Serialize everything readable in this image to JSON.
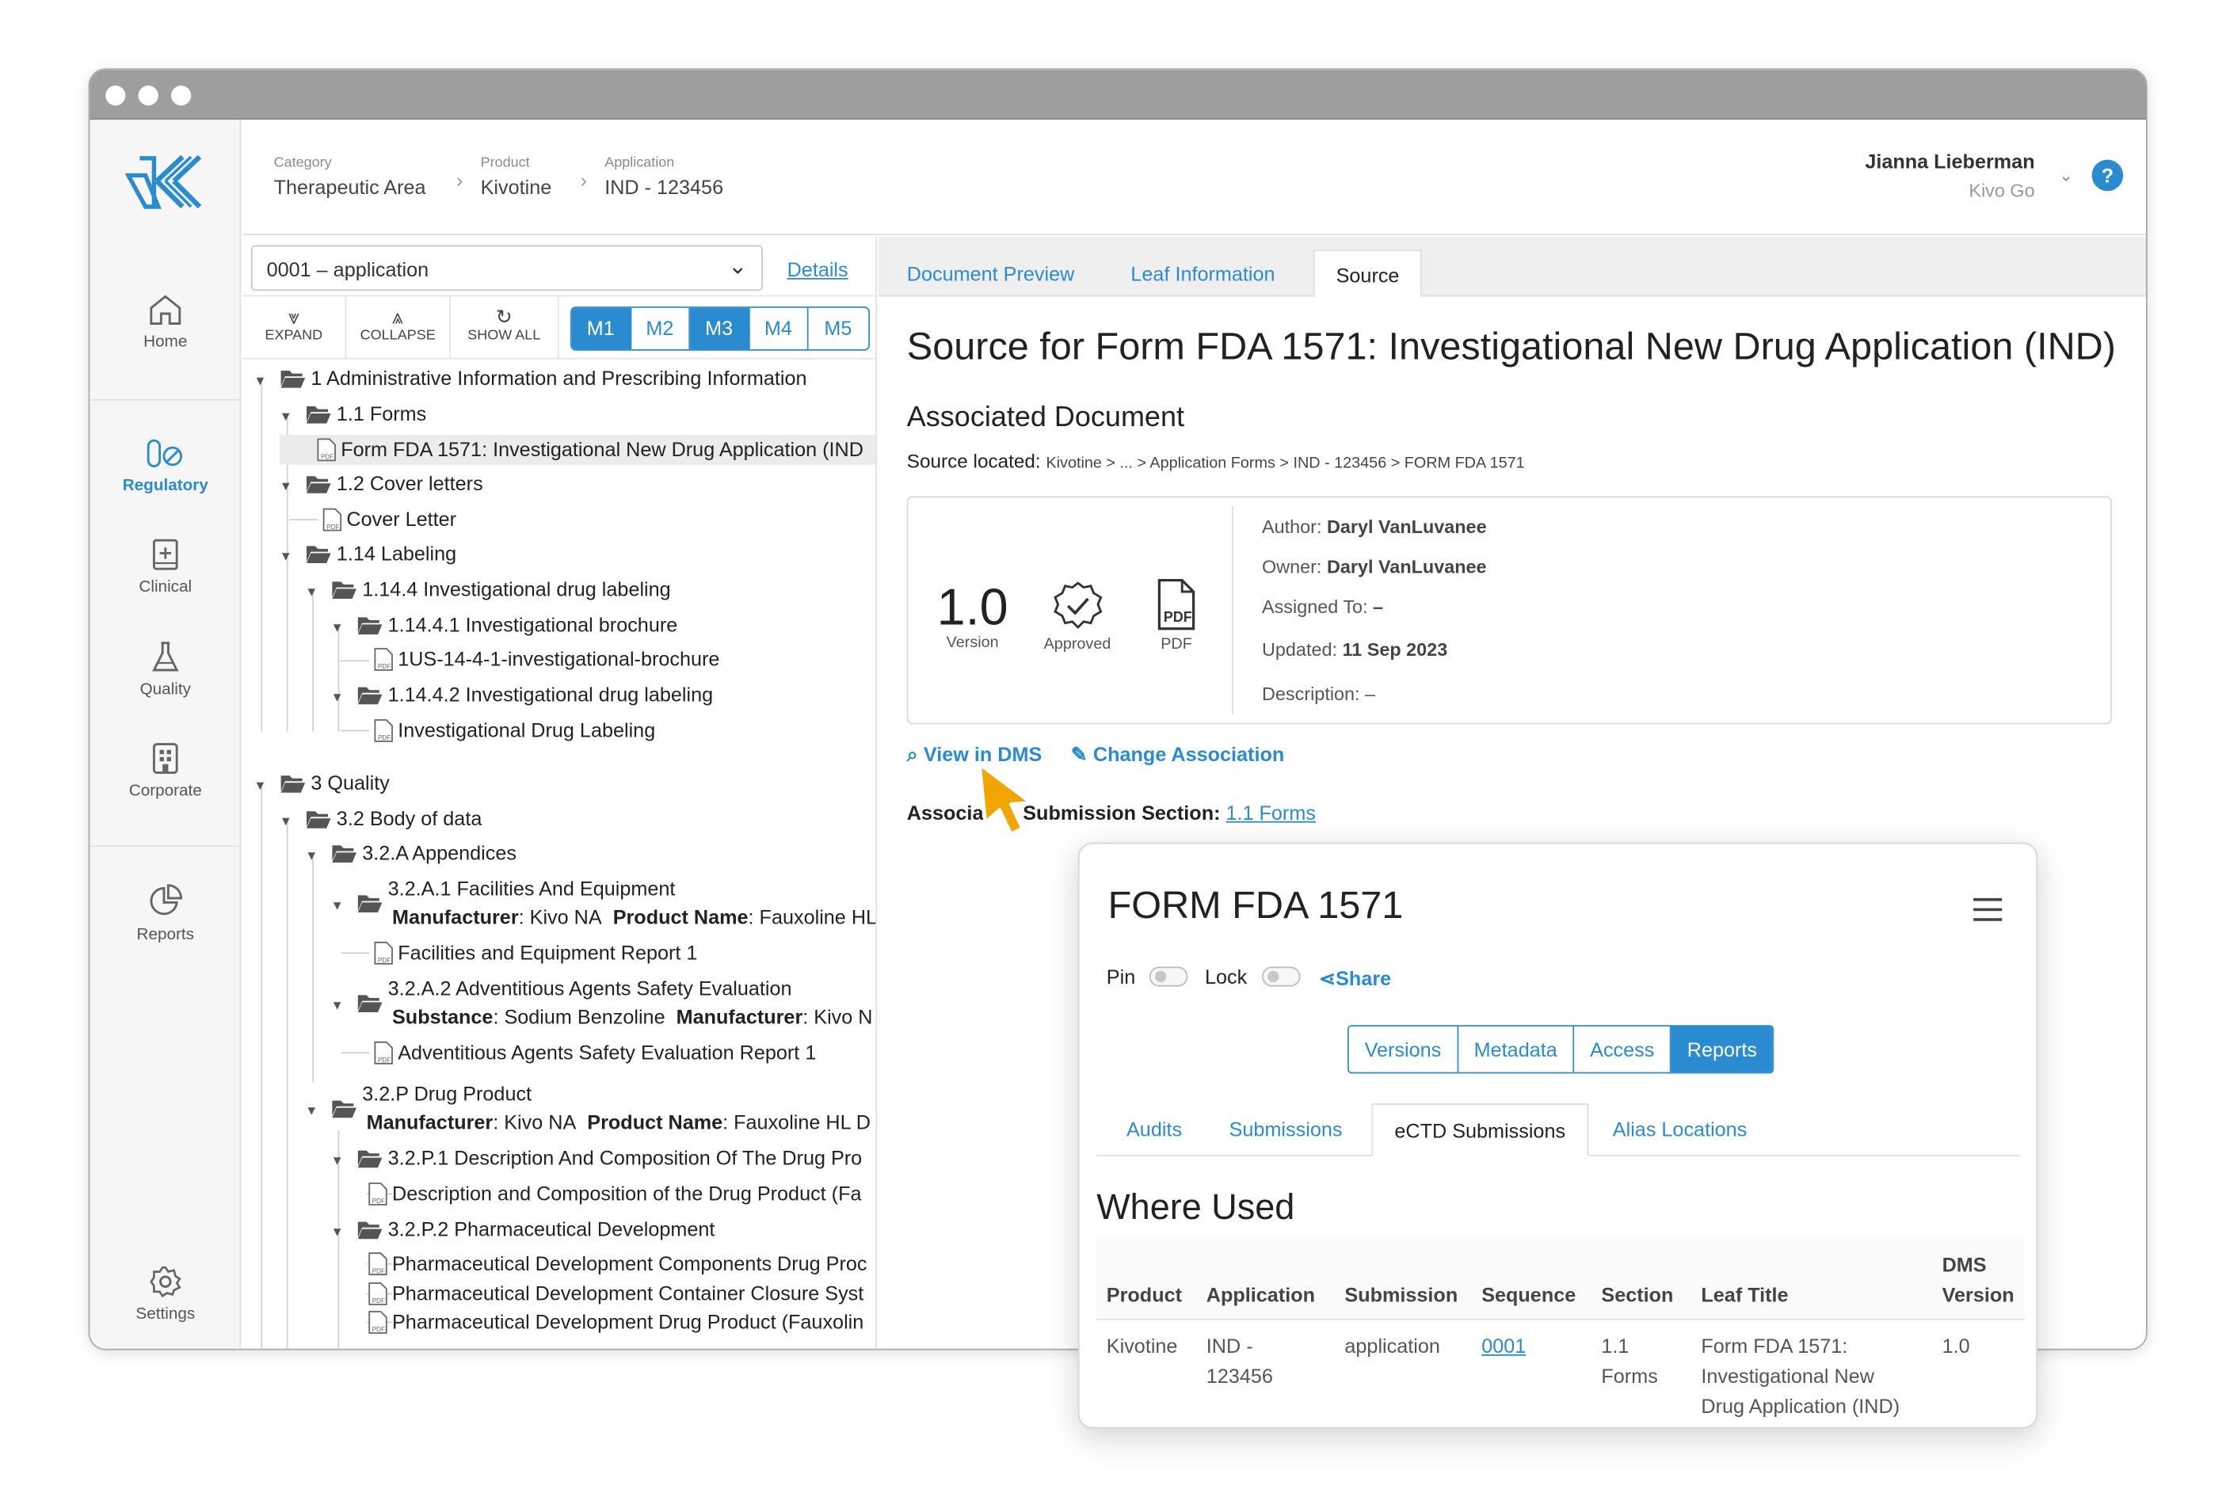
{
  "header": {
    "breadcrumbs": [
      {
        "label": "Category",
        "value": "Therapeutic Area"
      },
      {
        "label": "Product",
        "value": "Kivotine"
      },
      {
        "label": "Application",
        "value": "IND - 123456"
      }
    ],
    "user_name": "Jianna Lieberman",
    "user_org": "Kivo Go",
    "help_label": "?"
  },
  "sidebar": {
    "items": [
      {
        "label": "Home",
        "icon": "home-icon"
      },
      {
        "label": "Regulatory",
        "icon": "pill-icon",
        "active": true
      },
      {
        "label": "Clinical",
        "icon": "medical-book-icon"
      },
      {
        "label": "Quality",
        "icon": "flask-icon"
      },
      {
        "label": "Corporate",
        "icon": "building-icon"
      },
      {
        "label": "Reports",
        "icon": "pie-chart-icon"
      },
      {
        "label": "Settings",
        "icon": "gear-icon"
      }
    ]
  },
  "tree_pane": {
    "application_select": "0001 – application",
    "details_link": "Details",
    "toolbar": {
      "expand": "EXPAND",
      "collapse": "COLLAPSE",
      "show_all": "SHOW ALL"
    },
    "modules": [
      "M1",
      "M2",
      "M3",
      "M4",
      "M5"
    ],
    "active_modules": [
      "M1",
      "M3"
    ],
    "nodes": [
      {
        "label": "1 Administrative Information and Prescribing Information",
        "type": "folder"
      },
      {
        "label": "1.1 Forms",
        "type": "folder"
      },
      {
        "label": "Form FDA 1571: Investigational New Drug Application (IND",
        "type": "document",
        "selected": true
      },
      {
        "label": "1.2 Cover letters",
        "type": "folder"
      },
      {
        "label": "Cover Letter",
        "type": "document"
      },
      {
        "label": "1.14 Labeling",
        "type": "folder"
      },
      {
        "label": "1.14.4 Investigational drug labeling",
        "type": "folder"
      },
      {
        "label": "1.14.4.1 Investigational brochure",
        "type": "folder"
      },
      {
        "label": "1US-14-4-1-investigational-brochure",
        "type": "document"
      },
      {
        "label": "1.14.4.2 Investigational drug labeling",
        "type": "folder"
      },
      {
        "label": "Investigational Drug Labeling",
        "type": "document"
      },
      {
        "label": "3 Quality",
        "type": "folder"
      },
      {
        "label": "3.2 Body of data",
        "type": "folder"
      },
      {
        "label": "3.2.A Appendices",
        "type": "folder"
      },
      {
        "label": "3.2.A.1 Facilities And Equipment",
        "type": "folder"
      },
      {
        "label": "Facilities and Equipment Report 1",
        "type": "document"
      },
      {
        "label": "3.2.A.2 Adventitious Agents Safety Evaluation",
        "type": "folder"
      },
      {
        "label": "Adventitious Agents Safety Evaluation Report 1",
        "type": "document"
      },
      {
        "label": "3.2.P Drug Product",
        "type": "folder"
      },
      {
        "label": "3.2.P.1 Description And Composition Of The Drug Pro",
        "type": "folder"
      },
      {
        "label": "Description and Composition of the Drug Product (Fa",
        "type": "document"
      },
      {
        "label": "3.2.P.2 Pharmaceutical Development",
        "type": "folder"
      },
      {
        "label": "Pharmaceutical Development Components Drug Proc",
        "type": "document"
      },
      {
        "label": "Pharmaceutical Development Container Closure Syst",
        "type": "document"
      },
      {
        "label": "Pharmaceutical Development Drug Product (Fauxolin",
        "type": "document"
      }
    ],
    "attributes": {
      "a1_k1": "Manufacturer",
      "a1_v1": ": Kivo NA",
      "a1_k2": "Product Name",
      "a1_v2": ": Fauxoline HL",
      "a2_k1": "Substance",
      "a2_v1": ": Sodium Benzoline",
      "a2_k2": "Manufacturer",
      "a2_v2": ": Kivo N",
      "p_k1": "Manufacturer",
      "p_v1": ": Kivo NA",
      "p_k2": "Product Name",
      "p_v2": ": Fauxoline HL  D"
    }
  },
  "right_pane": {
    "tabs": [
      "Document Preview",
      "Leaf Information",
      "Source"
    ],
    "active_tab": "Source",
    "title": "Source for Form FDA 1571: Investigational New Drug Application (IND)",
    "associated_heading": "Associated Document",
    "source_located_label": "Source located:",
    "source_path": "Kivotine  >  ...  > Application Forms  > IND - 123456  > FORM FDA 1571",
    "doc_card": {
      "version": "1.0",
      "version_label": "Version",
      "status_label": "Approved",
      "format_label": "PDF",
      "author_label": "Author:",
      "author": "Daryl VanLuvanee",
      "owner_label": "Owner:",
      "owner": "Daryl VanLuvanee",
      "assigned_label": "Assigned To:",
      "assigned": "–",
      "updated_label": "Updated:",
      "updated": "11 Sep 2023",
      "description_label": "Description:",
      "description": "–"
    },
    "view_in_dms": "View in DMS",
    "change_association": "Change Association",
    "assoc_label_a": "Associat",
    "assoc_label_b": "Submission Section:",
    "assoc_link": "1.1 Forms"
  },
  "popup": {
    "title": "FORM FDA 1571",
    "pin_label": "Pin",
    "lock_label": "Lock",
    "share_label": "Share",
    "segments": [
      "Versions",
      "Metadata",
      "Access",
      "Reports"
    ],
    "active_segment": "Reports",
    "tabs": [
      "Audits",
      "Submissions",
      "eCTD Submissions",
      "Alias Locations"
    ],
    "active_tab": "eCTD Submissions",
    "section_title": "Where Used",
    "table": {
      "headers": [
        "Product",
        "Application",
        "Submission",
        "Sequence",
        "Section",
        "Leaf Title",
        "DMS Version"
      ],
      "rows": [
        {
          "product": "Kivotine",
          "application_1": "IND -",
          "application_2": "123456",
          "submission": "application",
          "sequence": "0001",
          "section_1": "1.1",
          "section_2": "Forms",
          "leaf_1": "Form FDA 1571:",
          "leaf_2": "Investigational New",
          "leaf_3": "Drug Application (IND)",
          "dms_version": "1.0"
        }
      ]
    }
  },
  "colors": {
    "accent": "#2a8bd1",
    "titlebar": "#9e9e9e",
    "cursor": "#f0a500"
  }
}
